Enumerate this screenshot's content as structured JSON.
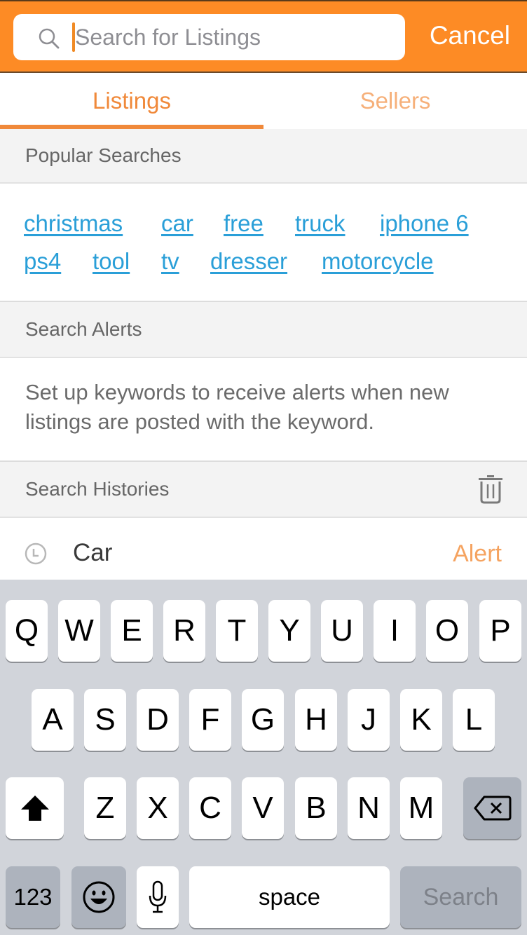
{
  "header": {
    "search_placeholder": "Search for Listings",
    "search_value": "",
    "cancel_label": "Cancel",
    "brand_color": "#fd8b25"
  },
  "tabs": [
    {
      "label": "Listings",
      "active": true
    },
    {
      "label": "Sellers",
      "active": false
    }
  ],
  "popular": {
    "title": "Popular Searches",
    "tags": [
      "christmas",
      "car",
      "free",
      "truck",
      "iphone 6",
      "ps4",
      "tool",
      "tv",
      "dresser",
      "motorcycle"
    ],
    "link_color": "#2a9fd8"
  },
  "alerts": {
    "title": "Search Alerts",
    "description": "Set up keywords to receive alerts when new listings are posted with the keyword."
  },
  "history": {
    "title": "Search Histories",
    "clear_icon": "trash-icon",
    "items": [
      {
        "term": "Car",
        "action_label": "Alert"
      }
    ]
  },
  "keyboard": {
    "row1": [
      "Q",
      "W",
      "E",
      "R",
      "T",
      "Y",
      "U",
      "I",
      "O",
      "P"
    ],
    "row2": [
      "A",
      "S",
      "D",
      "F",
      "G",
      "H",
      "J",
      "K",
      "L"
    ],
    "row3": [
      "Z",
      "X",
      "C",
      "V",
      "B",
      "N",
      "M"
    ],
    "numbers_label": "123",
    "space_label": "space",
    "return_label": "Search",
    "shift_icon": "shift-icon",
    "delete_icon": "backspace-icon",
    "emoji_icon": "emoji-icon",
    "mic_icon": "microphone-icon"
  }
}
